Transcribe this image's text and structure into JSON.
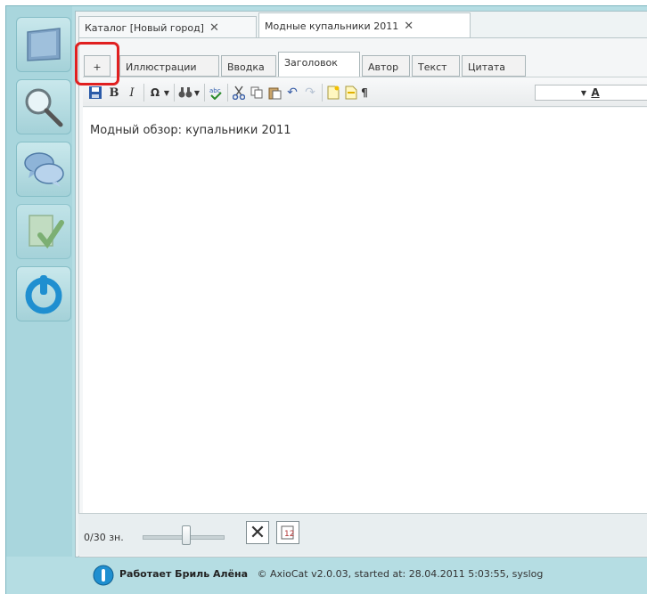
{
  "doc_tabs": [
    {
      "label": "Каталог [Новый город]",
      "close": "✕"
    },
    {
      "label": "Модные купальники 2011",
      "close": "✕"
    }
  ],
  "field_tabs": {
    "add": "+",
    "items": [
      "Иллюстрации",
      "Вводка",
      "Заголовок",
      "Автор",
      "Текст",
      "Цитата"
    ],
    "active": "Заголовок"
  },
  "toolbar": {
    "bold": "B",
    "italic": "I",
    "omega": "Ω",
    "find": "⚇",
    "pilcrow": "¶",
    "font_color_label": "A"
  },
  "editor": {
    "content": "Модный обзор: купальники 2011"
  },
  "bottom": {
    "counter": "0/30 зн.",
    "clear_glyph": "✕"
  },
  "status": {
    "user": "Работает Бриль Алёна",
    "info": "© AxioCat v2.0.03, started at: 28.04.2011 5:03:55, syslog"
  },
  "colors": {
    "sidebar_bg": "#a9d6dd",
    "accent_highlight": "#e02020",
    "power_blue": "#1f8fd0"
  }
}
